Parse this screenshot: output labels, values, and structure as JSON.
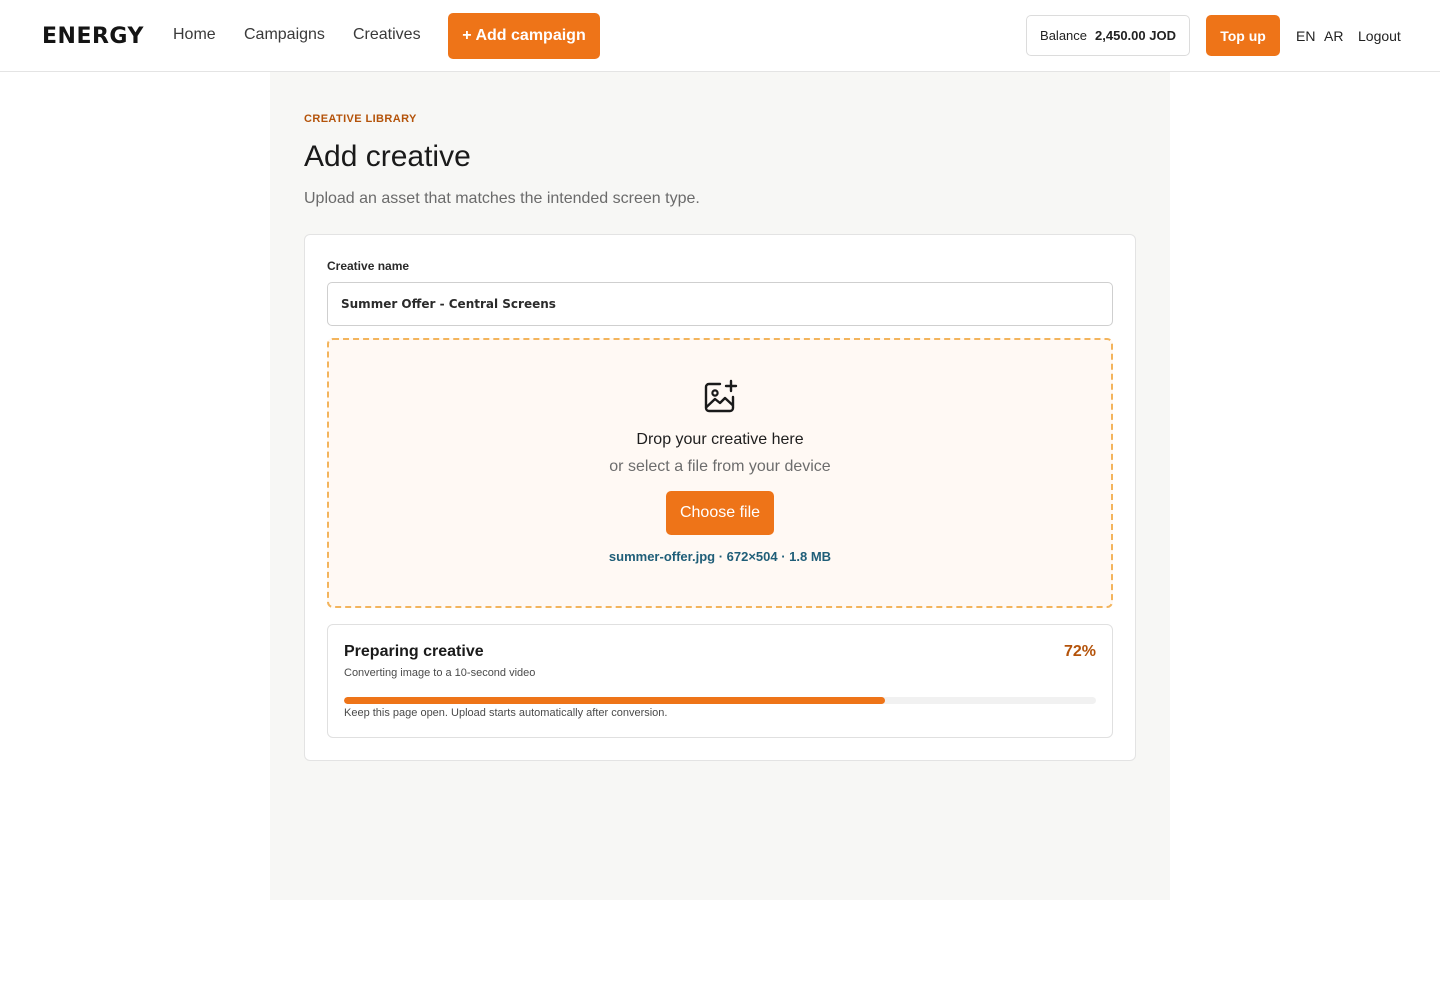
{
  "header": {
    "brand": "ENERGY",
    "nav": [
      "Home",
      "Campaigns",
      "Creatives"
    ],
    "add_campaign_label": "+ Add campaign",
    "balance_label": "Balance",
    "balance_amount": "2,450.00 JOD",
    "topup_label": "Top up",
    "lang_en": "EN",
    "lang_ar": "AR",
    "logout_label": "Logout"
  },
  "page": {
    "eyebrow": "CREATIVE LIBRARY",
    "title": "Add creative",
    "subtitle": "Upload an asset that matches the intended screen type."
  },
  "form": {
    "name_label": "Creative name",
    "name_value": "Summer Offer - Central Screens"
  },
  "dropzone": {
    "icon": "image-plus-icon",
    "title": "Drop your creative here",
    "subtitle": "or select a file from your device",
    "button_label": "Choose file",
    "file_info": "summer-offer.jpg · 672×504 · 1.8 MB"
  },
  "progress": {
    "title": "Preparing creative",
    "percent_label": "72%",
    "percent": 72,
    "subtitle": "Converting image to a 10-second video",
    "note": "Keep this page open. Upload starts automatically after conversion."
  },
  "colors": {
    "accent": "#ee7418",
    "eyebrow": "#b4530a",
    "file_info": "#1f5e78",
    "dropzone_border": "#f3b45c"
  }
}
